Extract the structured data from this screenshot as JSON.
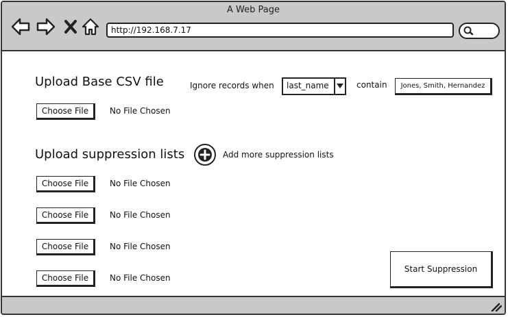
{
  "browser": {
    "title": "A Web Page",
    "url": "http://192.168.7.17",
    "icons": [
      "back-arrow-icon",
      "forward-arrow-icon",
      "close-x-icon",
      "home-icon",
      "search-icon",
      "resize-grip-icon"
    ]
  },
  "base_upload": {
    "heading": "Upload Base CSV file",
    "choose_label": "Choose File",
    "status": "No File Chosen"
  },
  "filter": {
    "ignore_label": "Ignore records when",
    "field_value": "last_name",
    "contain_label": "contain",
    "names_value": "Jones, Smith, Hernandez"
  },
  "suppression": {
    "heading": "Upload suppression lists",
    "add_more_label": "Add more suppression lists",
    "files": [
      {
        "choose_label": "Choose File",
        "status": "No File Chosen"
      },
      {
        "choose_label": "Choose File",
        "status": "No File Chosen"
      },
      {
        "choose_label": "Choose File",
        "status": "No File Chosen"
      },
      {
        "choose_label": "Choose File",
        "status": "No File Chosen"
      }
    ]
  },
  "actions": {
    "start_label": "Start Suppression"
  }
}
